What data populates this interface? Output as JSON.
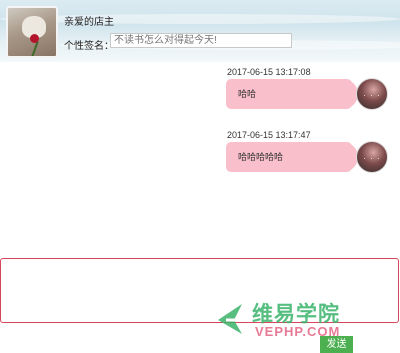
{
  "header": {
    "shop_name": "亲爱的店主",
    "signature_label": "个性签名：",
    "signature_placeholder": "不读书怎么对得起今天!"
  },
  "messages": [
    {
      "timestamp": "2017-06-15 13:17:08",
      "text": "哈哈",
      "avatar_text": "· · ·"
    },
    {
      "timestamp": "2017-06-15 13:17:47",
      "text": "哈哈哈哈哈",
      "avatar_text": "· · ·"
    }
  ],
  "composer": {
    "value": "",
    "send_label": "发送"
  },
  "watermark": {
    "title": "维易学院",
    "url": "VEPHP.COM"
  },
  "colors": {
    "bubble": "#f9bfcb",
    "input_border": "#d9455a",
    "send_button": "#4caf50",
    "watermark_green": "#39b36a",
    "watermark_pink": "#e25a7a"
  }
}
